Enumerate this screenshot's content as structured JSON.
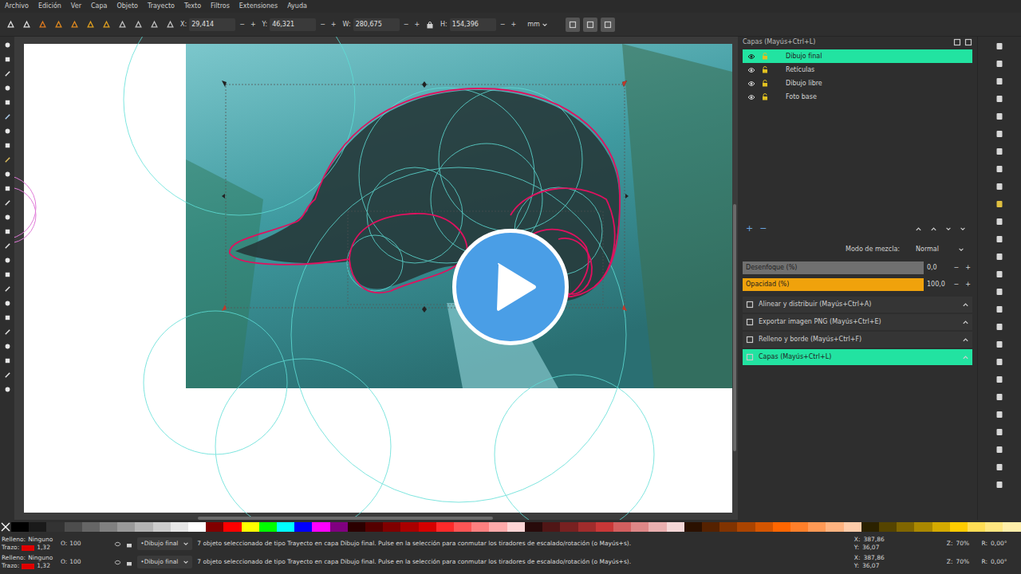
{
  "menu": [
    "Archivo",
    "Edición",
    "Ver",
    "Capa",
    "Objeto",
    "Trayecto",
    "Texto",
    "Filtros",
    "Extensiones",
    "Ayuda"
  ],
  "toolbar": {
    "fields": [
      {
        "label": "X:",
        "value": "29,414"
      },
      {
        "label": "Y:",
        "value": "46,321"
      },
      {
        "label": "W:",
        "value": "280,675"
      },
      {
        "label": "H:",
        "value": "154,396"
      }
    ],
    "minus": "−",
    "plus": "+",
    "unit": "mm",
    "lock_ratio": true
  },
  "layers_panel": {
    "title": "Capas (Mayús+Ctrl+L)",
    "layers": [
      {
        "name": "Dibujo final",
        "selected": true,
        "visible": true,
        "locked": false
      },
      {
        "name": "Retículas",
        "selected": false,
        "visible": true,
        "locked": false
      },
      {
        "name": "Dibujo libre",
        "selected": false,
        "visible": true,
        "locked": false
      },
      {
        "name": "Foto base",
        "selected": false,
        "visible": true,
        "locked": false
      }
    ],
    "add": "+",
    "remove": "−",
    "blend_label": "Modo de mezcla:",
    "blend_value": "Normal",
    "blur": {
      "label": "Desenfoque (%)",
      "value": "0,0",
      "level": 0
    },
    "opacity": {
      "label": "Opacidad (%)",
      "value": "100,0",
      "level": 1
    },
    "minus": "−",
    "plus": "+"
  },
  "docks": [
    {
      "label": "Alinear y distribuir (Mayús+Ctrl+A)",
      "selected": false
    },
    {
      "label": "Exportar imagen PNG (Mayús+Ctrl+E)",
      "selected": false
    },
    {
      "label": "Relleno y borde (Mayús+Ctrl+F)",
      "selected": false
    },
    {
      "label": "Capas (Mayús+Ctrl+L)",
      "selected": true
    }
  ],
  "palette": [
    "#000000",
    "#1a1a1a",
    "#333333",
    "#4d4d4d",
    "#666666",
    "#808080",
    "#999999",
    "#b3b3b3",
    "#cccccc",
    "#e6e6e6",
    "#ffffff",
    "#800000",
    "#ff0000",
    "#ffff00",
    "#00ff00",
    "#00ffff",
    "#0000ff",
    "#ff00ff",
    "#800080",
    "#2b0000",
    "#550000",
    "#800000",
    "#aa0000",
    "#d40000",
    "#ff2a2a",
    "#ff5555",
    "#ff8080",
    "#ffaaaa",
    "#ffd5d5",
    "#280b0b",
    "#501616",
    "#782121",
    "#a02c2c",
    "#c83737",
    "#d35f5f",
    "#de8787",
    "#e9afaf",
    "#f4d7d7",
    "#2b1100",
    "#552200",
    "#803300",
    "#aa4400",
    "#d45500",
    "#ff6600",
    "#ff7f2a",
    "#ff9955",
    "#ffb380",
    "#ffccaa",
    "#2b2200",
    "#554400",
    "#806600",
    "#aa8800",
    "#d4aa00",
    "#ffcc00",
    "#ffdd55",
    "#ffe680",
    "#ffeeaa"
  ],
  "status_rows": [
    {
      "fill_label": "Relleno:",
      "fill": "Ninguno",
      "stroke_label": "Trazo:",
      "stroke_color": "#e00000",
      "stroke_width": "1,32",
      "opacity_label": "O:",
      "opacity": "100",
      "layer": "•Dibujo final",
      "message": "7 objeto seleccionado de tipo Trayecto en capa Dibujo final. Pulse en la selección para conmutar los tiradores de escalado/rotación (o Mayús+s).",
      "x_label": "X:",
      "x": "387,86",
      "y_label": "Y:",
      "y": "36,07",
      "zoom_label": "Z:",
      "zoom": "70%",
      "rot_label": "R:",
      "rot": "0,00°"
    },
    {
      "fill_label": "Relleno:",
      "fill": "Ninguno",
      "stroke_label": "Trazo:",
      "stroke_color": "#e00000",
      "stroke_width": "1,32",
      "opacity_label": "O:",
      "opacity": "100",
      "layer": "•Dibujo final",
      "message": "7 objeto seleccionado de tipo Trayecto en capa Dibujo final. Pulse en la selección para conmutar los tiradores de escalado/rotación (o Mayús+s).",
      "x_label": "X:",
      "x": "387,86",
      "y_label": "Y:",
      "y": "36,07",
      "zoom_label": "Z:",
      "zoom": "70%",
      "rot_label": "R:",
      "rot": "0,00°"
    }
  ],
  "video": {
    "playing": false
  }
}
